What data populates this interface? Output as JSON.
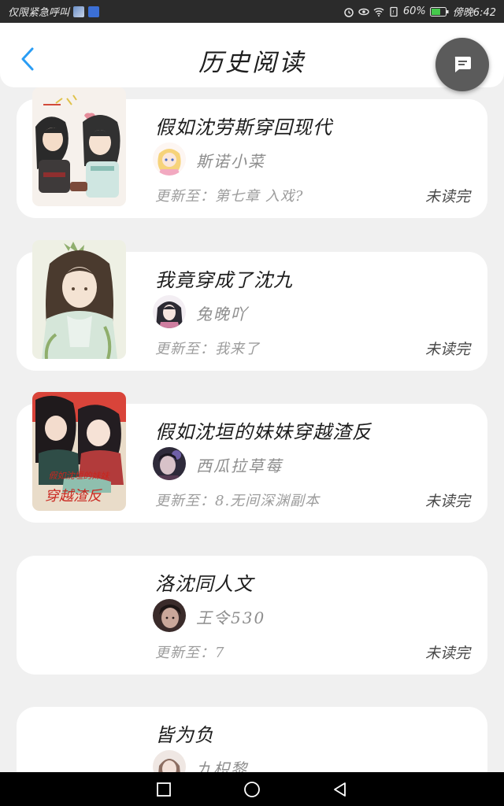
{
  "status_bar": {
    "carrier": "仅限紧急呼叫",
    "battery": "60%",
    "time": "傍晚6:42"
  },
  "header": {
    "title": "历史阅读"
  },
  "labels": {
    "update_prefix": "更新至：",
    "unread": "未读完"
  },
  "books": [
    {
      "title": "假如沈劳斯穿回现代",
      "author": "斯诺小菜",
      "update": "第七章 入戏?",
      "status": "未读完"
    },
    {
      "title": "我竟穿成了沈九",
      "author": "兔晚吖",
      "update": "我来了",
      "status": "未读完"
    },
    {
      "title": "假如沈垣的妹妹穿越渣反",
      "author": "西瓜拉草莓",
      "update": "8.无间深渊副本",
      "status": "未读完"
    },
    {
      "title": "洛沈同人文",
      "author": "王令530",
      "update": "7",
      "status": "未读完"
    },
    {
      "title": "皆为负",
      "author": "九枳黎",
      "update": "",
      "status": ""
    }
  ],
  "cover_text": {
    "book3": "假如沈垣的妹妹穿越渣反"
  },
  "colors": {
    "accent": "#2a9df4",
    "background": "#f0f0f0",
    "card": "#ffffff",
    "fab": "#5b5b5b"
  },
  "icons": {
    "back": "chevron-left-icon",
    "chat": "chat-bubble-icon",
    "nav_recent": "square-icon",
    "nav_home": "circle-icon",
    "nav_back": "triangle-back-icon"
  }
}
